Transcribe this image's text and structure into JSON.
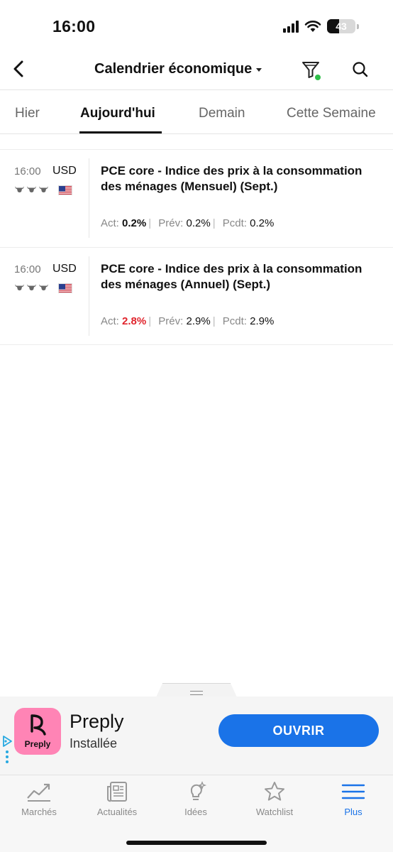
{
  "status_bar": {
    "time": "16:00",
    "battery": "43"
  },
  "header": {
    "title": "Calendrier économique"
  },
  "tabs": [
    {
      "label": "Hier"
    },
    {
      "label": "Aujourd'hui"
    },
    {
      "label": "Demain"
    },
    {
      "label": "Cette Semaine"
    }
  ],
  "active_tab": "Aujourd'hui",
  "events": [
    {
      "time": "16:00",
      "currency": "USD",
      "importance": 3,
      "title": "PCE core - Indice des prix à la consommation des ménages (Mensuel) (Sept.)",
      "act_label": "Act:",
      "act_value": "0.2%",
      "prev_label": "Prév:",
      "prev_value": "0.2%",
      "pcdt_label": "Pcdt:",
      "pcdt_value": "0.2%"
    },
    {
      "time": "16:00",
      "currency": "USD",
      "importance": 3,
      "title": "PCE core - Indice des prix à la consommation des ménages (Annuel) (Sept.)",
      "act_label": "Act:",
      "act_value": "2.8%",
      "act_color": "#e0242c",
      "prev_label": "Prév:",
      "prev_value": "2.9%",
      "pcdt_label": "Pcdt:",
      "pcdt_value": "2.9%"
    }
  ],
  "ad": {
    "app_name": "Preply",
    "icon_label": "Preply",
    "status": "Installée",
    "button": "OUVRIR"
  },
  "bottom_nav": [
    {
      "label": "Marchés",
      "icon": "chart-trend-icon"
    },
    {
      "label": "Actualités",
      "icon": "newspaper-icon"
    },
    {
      "label": "Idées",
      "icon": "lightbulb-icon"
    },
    {
      "label": "Watchlist",
      "icon": "star-icon"
    },
    {
      "label": "Plus",
      "icon": "menu-icon"
    }
  ],
  "colors": {
    "accent": "#1a73e8",
    "negative": "#e0242c",
    "filter_dot": "#2fbf4a",
    "ad_icon_bg": "#ff84b5"
  }
}
